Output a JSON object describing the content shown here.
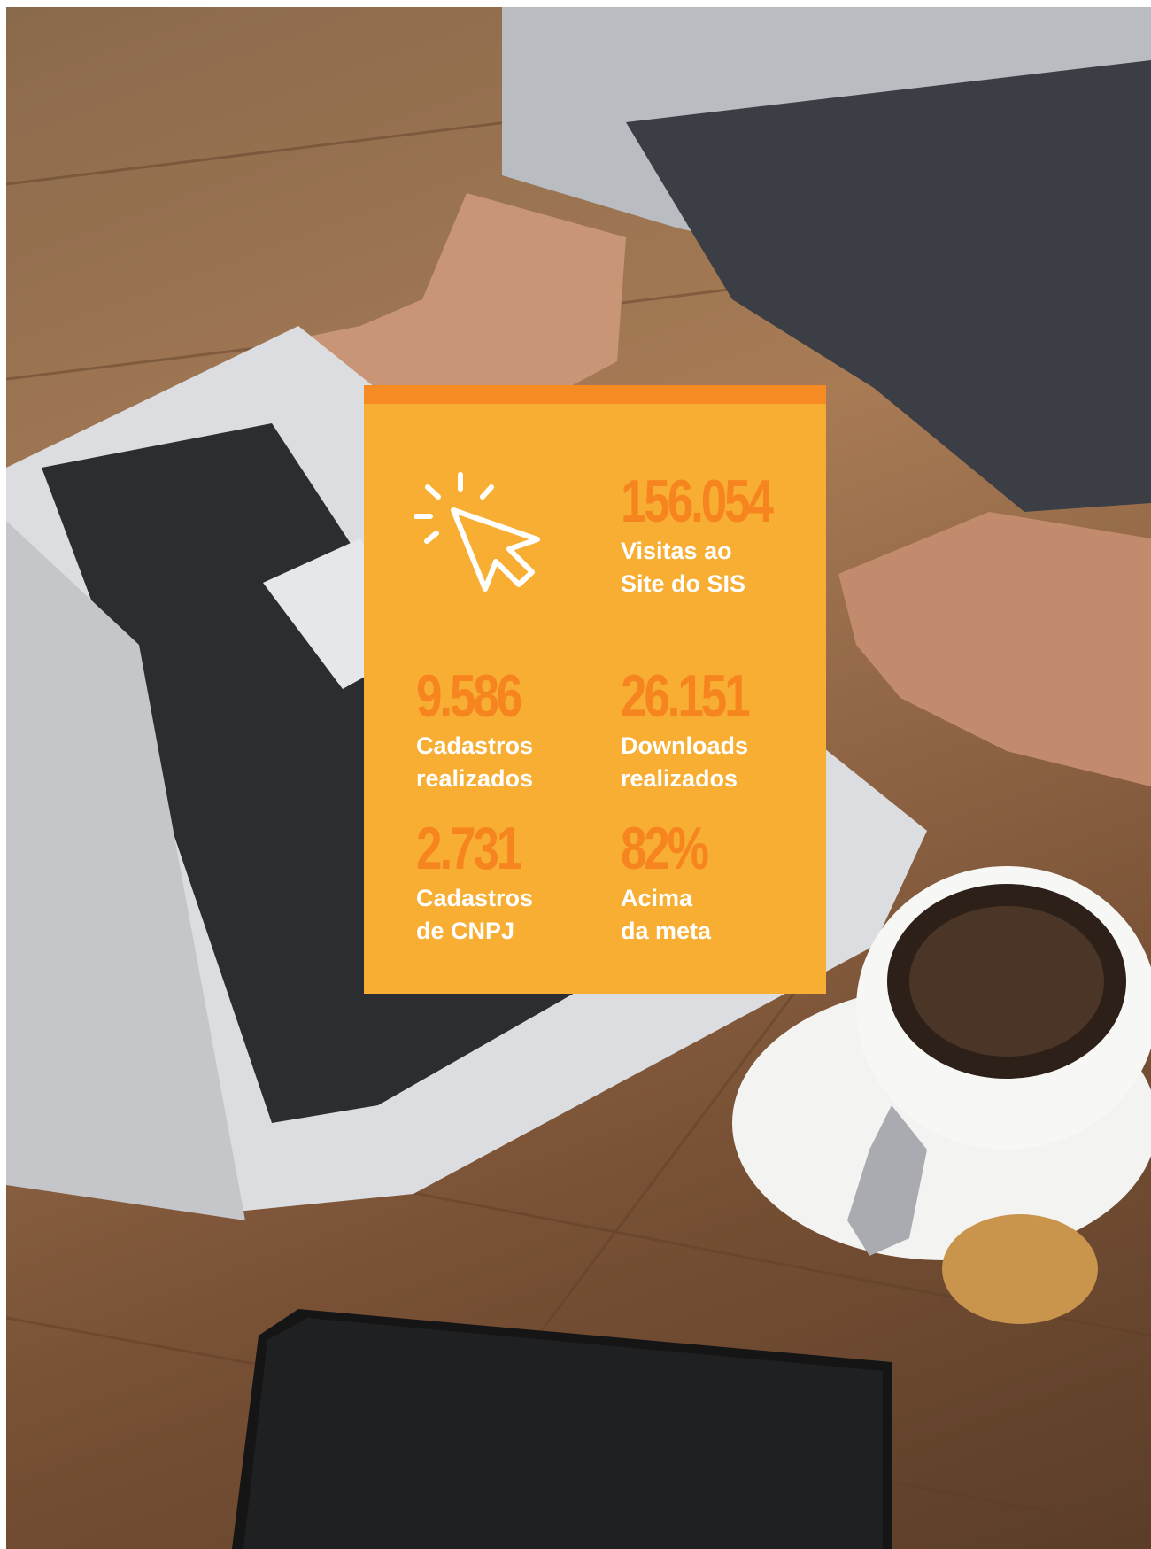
{
  "stats": [
    {
      "value": "156.054",
      "line1": "Visitas ao",
      "line2": "Site do SIS"
    },
    {
      "value": "9.586",
      "line1": "Cadastros",
      "line2": "realizados"
    },
    {
      "value": "26.151",
      "line1": "Downloads",
      "line2": "realizados"
    },
    {
      "value": "2.731",
      "line1": "Cadastros",
      "line2": "de CNPJ"
    },
    {
      "value": "82%",
      "line1": "Acima",
      "line2": "da meta"
    }
  ],
  "icon": "click-cursor-icon",
  "colors": {
    "card": "#f8ae32",
    "card_bar": "#f78b23",
    "value": "#f7851f",
    "label": "#ffffff"
  }
}
